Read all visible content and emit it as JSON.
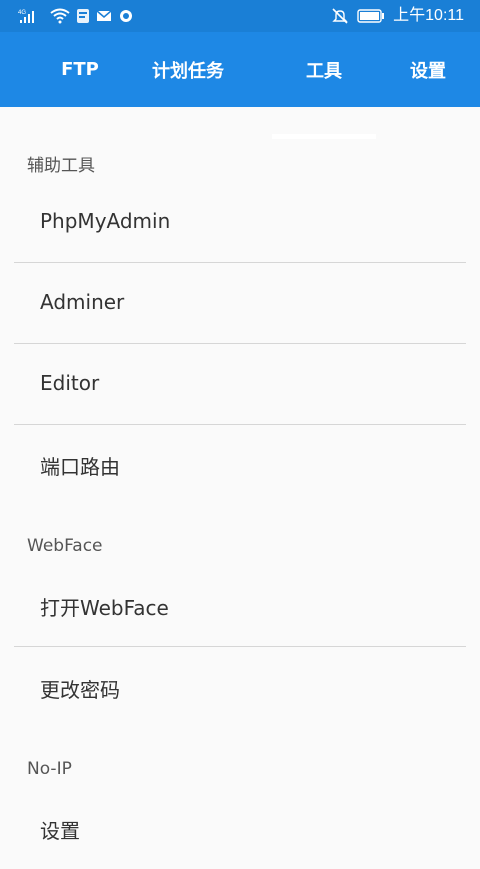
{
  "status_bar": {
    "network": "4G",
    "time": "上午10:11",
    "icons": [
      "signal-icon",
      "wifi-icon",
      "app-icon",
      "mail-icon",
      "circle-icon",
      "mute-icon",
      "battery-icon"
    ]
  },
  "tabs": [
    {
      "label": "FTP",
      "selected": false
    },
    {
      "label": "计划任务",
      "selected": false
    },
    {
      "label": "工具",
      "selected": true
    },
    {
      "label": "设置",
      "selected": false
    }
  ],
  "colors": {
    "primary": "#1e88e5",
    "statusbar": "#1a7fd6",
    "background": "#fafafa"
  },
  "sections": [
    {
      "title": "辅助工具",
      "items": [
        {
          "label": "PhpMyAdmin"
        },
        {
          "label": "Adminer"
        },
        {
          "label": "Editor"
        },
        {
          "label": "端口路由"
        }
      ]
    },
    {
      "title": "WebFace",
      "items": [
        {
          "label": "打开WebFace"
        },
        {
          "label": "更改密码"
        }
      ]
    },
    {
      "title": "No-IP",
      "items": [
        {
          "label": "设置"
        }
      ]
    }
  ]
}
